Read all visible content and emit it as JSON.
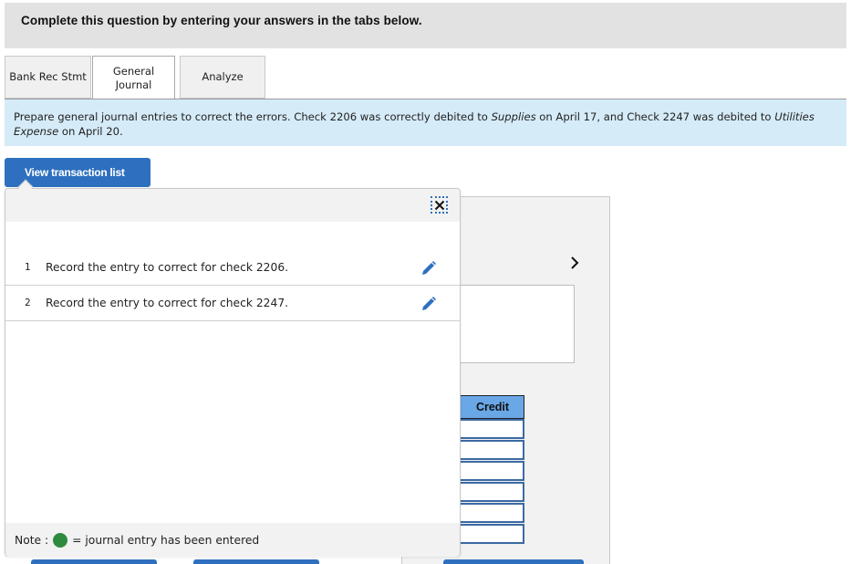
{
  "header": {
    "title": "Complete this question by entering your answers in the tabs below."
  },
  "tabs": [
    {
      "label": "Bank Rec Stmt",
      "active": false
    },
    {
      "label_line1": "General",
      "label_line2": "Journal",
      "active": true
    },
    {
      "label": "Analyze",
      "active": false
    }
  ],
  "instruction": {
    "part1": "Prepare general journal entries to correct the errors. Check 2206 was correctly debited to ",
    "em1": "Supplies",
    "part2": " on April 17, and Check 2247 was debited to ",
    "em2": "Utilities Expense",
    "part3": " on April 20."
  },
  "view_transaction_button": "View transaction list",
  "popup": {
    "close_icon": "close-icon",
    "transactions": [
      {
        "number": "1",
        "text": "Record the entry to correct for check 2206.",
        "icon": "pencil-icon"
      },
      {
        "number": "2",
        "text": "Record the entry to correct for check 2247.",
        "icon": "pencil-icon"
      }
    ],
    "note_prefix": "Note :",
    "note_suffix": "= journal entry has been entered",
    "note_dot_color": "#2e8b3e"
  },
  "journal_table": {
    "credit_header": "Credit",
    "credit_values": [
      "",
      "",
      "",
      "",
      "",
      ""
    ]
  },
  "colors": {
    "accent": "#2e70bf",
    "instruction_bg": "#d5ebf8",
    "header_bg": "#e2e2e2",
    "credit_header_bg": "#6aa7e6"
  }
}
